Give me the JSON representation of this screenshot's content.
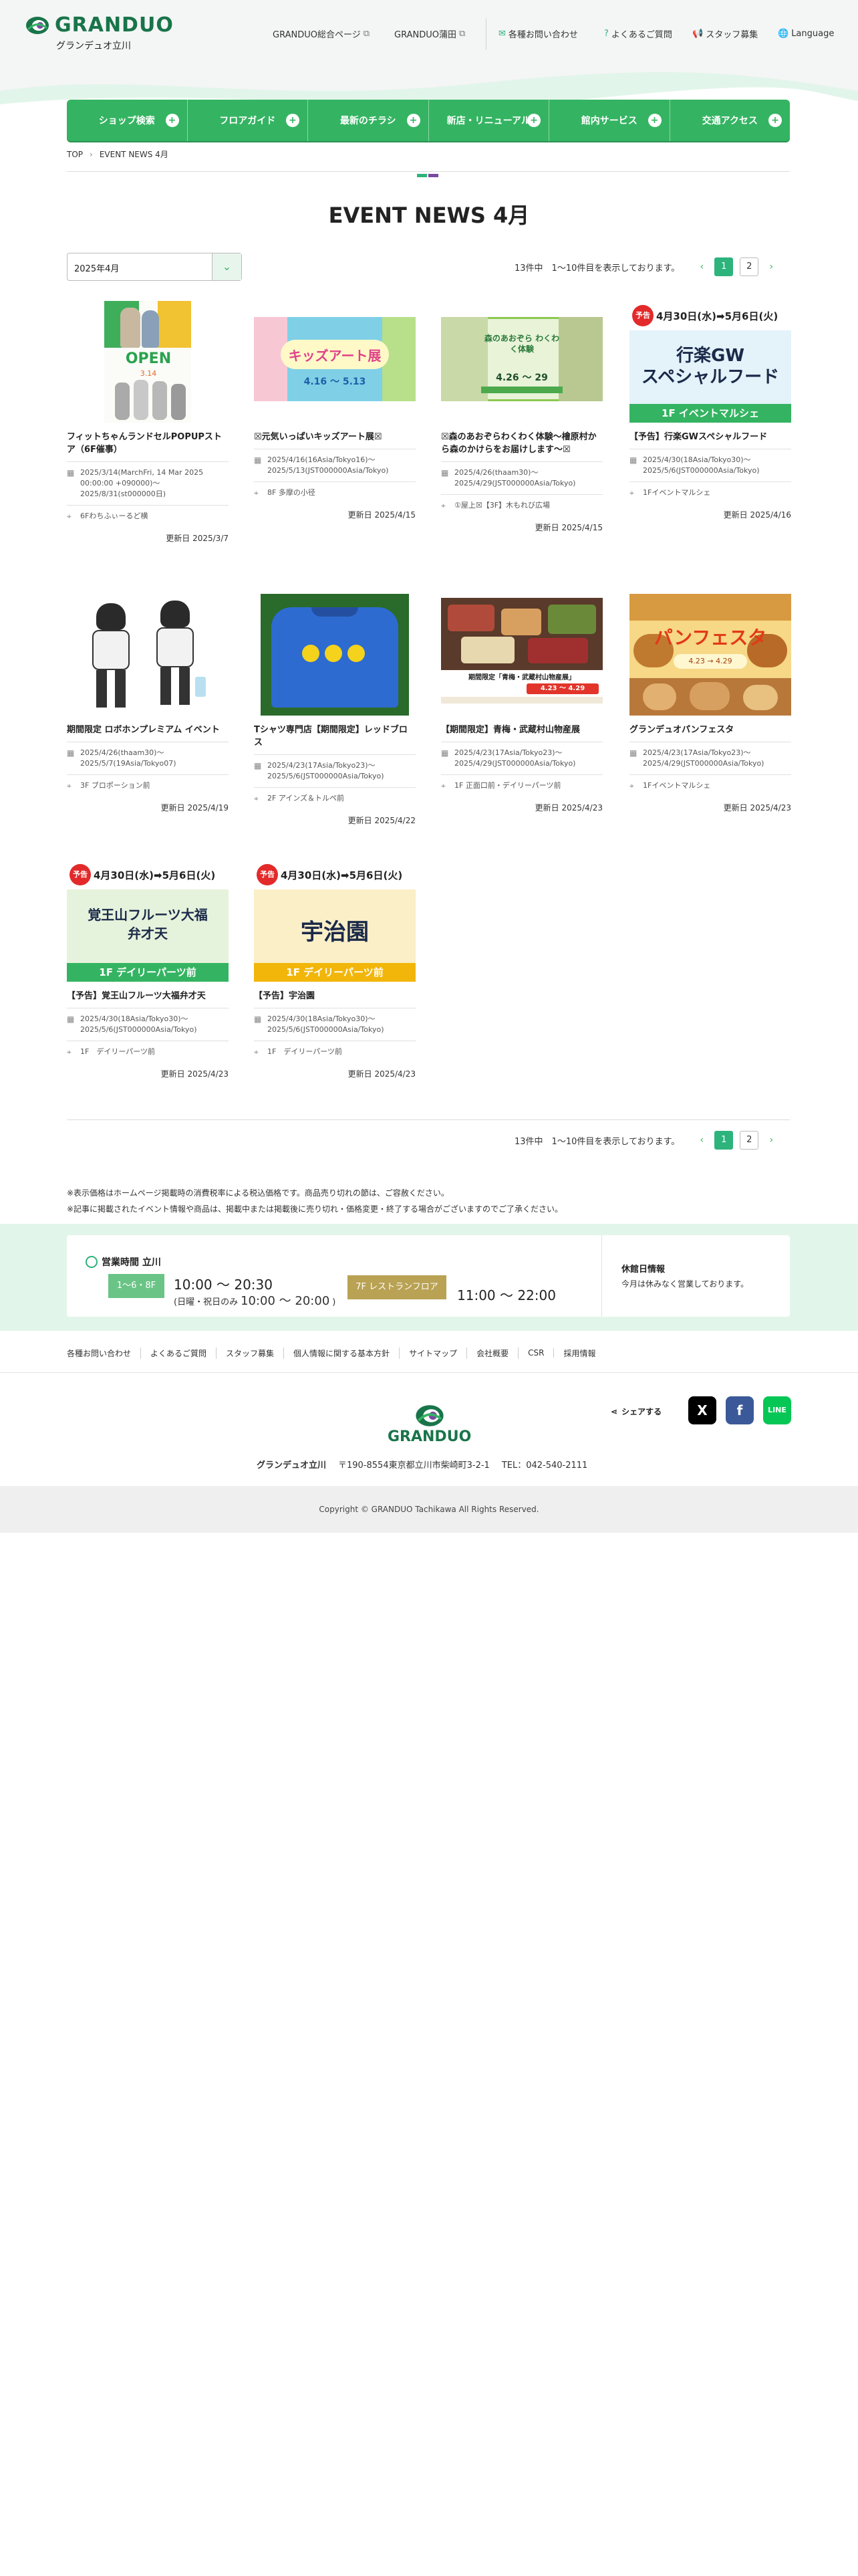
{
  "header": {
    "logo_text": "GRANDUO",
    "logo_sub": "グランデュオ立川",
    "util": [
      {
        "label": "GRANDUO総合ページ",
        "icon": "external-link-icon"
      },
      {
        "label": "GRANDUO蒲田",
        "icon": "external-link-icon"
      },
      {
        "label": "各種お問い合わせ",
        "icon": "mail-icon"
      },
      {
        "label": "よくあるご質問",
        "icon": "question-icon"
      },
      {
        "label": "スタッフ募集",
        "icon": "megaphone-icon"
      },
      {
        "label": "Language",
        "icon": "globe-icon"
      }
    ]
  },
  "nav": {
    "items": [
      "ショップ検索",
      "フロアガイド",
      "最新のチラシ",
      "新店・リニューアル",
      "館内サービス",
      "交通アクセス"
    ]
  },
  "breadcrumb": {
    "home": "TOP",
    "current": "EVENT NEWS 4月"
  },
  "page_title": "EVENT NEWS 4月",
  "filter": {
    "selected": "2025年4月"
  },
  "pagination": {
    "summary": "13件中　1〜10件目を表示しております。",
    "pages": [
      "1",
      "2"
    ],
    "current": "1",
    "prev": "‹",
    "next": "›"
  },
  "cards": [
    {
      "title": "フィットちゃんランドセルPOPUPストア（6F催事）",
      "date": "2025/3/14(MarchFri, 14 Mar 2025 00:00:00 +090000)〜2025/8/31(st000000日)",
      "place": "6Fわちふぃーるど横",
      "updated": "更新日 2025/3/7",
      "thumb": {
        "caption": "OPEN",
        "sub": "3.14"
      }
    },
    {
      "title": "☒元気いっぱいキッズアート展☒",
      "date": "2025/4/16(16Asia/Tokyo16)〜2025/5/13(JST000000Asia/Tokyo)",
      "place": "8F 多摩の小径",
      "updated": "更新日 2025/4/15",
      "thumb": {
        "caption": "キッズアート展",
        "sub": "4.16 〜 5.13"
      }
    },
    {
      "title": "☒森のあおぞらわくわく体験〜檜原村から森のかけらをお届けします〜☒",
      "date": "2025/4/26(thaam30)〜2025/4/29(JST000000Asia/Tokyo)",
      "place": "①屋上☒【3F】木もれび広場",
      "updated": "更新日 2025/4/15",
      "thumb": {
        "caption": "森のあおぞら わくわく体験",
        "sub": "4.26 〜 29"
      }
    },
    {
      "title": "【予告】行楽GWスペシャルフード",
      "date": "2025/4/30(18Asia/Tokyo30)〜2025/5/6(JST000000Asia/Tokyo)",
      "place": "1Fイベントマルシェ",
      "updated": "更新日 2025/4/16",
      "thumb": {
        "badge": "予告",
        "dates": "4月30日(水)➡5月6日(火)",
        "caption": "行楽GW\nスペシャルフード",
        "band": "1F イベントマルシェ"
      }
    },
    {
      "title": "期間限定 ロボホンプレミアム イベント",
      "date": "2025/4/26(thaam30)〜2025/5/7(19Asia/Tokyo07)",
      "place": "3F ブロポーション前",
      "updated": "更新日 2025/4/19",
      "thumb": {}
    },
    {
      "title": "Tシャツ専門店【期間限定】レッドブロス",
      "date": "2025/4/23(17Asia/Tokyo23)〜2025/5/6(JST000000Asia/Tokyo)",
      "place": "2F アインズ＆トルペ前",
      "updated": "更新日 2025/4/22",
      "thumb": {}
    },
    {
      "title": "【期間限定】青梅・武蔵村山物産展",
      "date": "2025/4/23(17Asia/Tokyo23)〜2025/4/29(JST000000Asia/Tokyo)",
      "place": "1F 正面口前・デイリーパーツ前",
      "updated": "更新日 2025/4/23",
      "thumb": {
        "caption": "期間限定「青梅・武蔵村山物産展」",
        "sub": "4.23 〜 4.29"
      }
    },
    {
      "title": "グランデュオパンフェスタ",
      "date": "2025/4/23(17Asia/Tokyo23)〜2025/4/29(JST000000Asia/Tokyo)",
      "place": "1Fイベントマルシェ",
      "updated": "更新日 2025/4/23",
      "thumb": {
        "caption": "パンフェスタ",
        "sub": "4.23 → 4.29"
      }
    },
    {
      "title": "【予告】覚王山フルーツ大福弁才天",
      "date": "2025/4/30(18Asia/Tokyo30)〜2025/5/6(JST000000Asia/Tokyo)",
      "place": "1F　デイリーパーツ前",
      "updated": "更新日 2025/4/23",
      "thumb": {
        "badge": "予告",
        "dates": "4月30日(水)➡5月6日(火)",
        "caption": "覚王山フルーツ大福\n弁才天",
        "band": "1F デイリーパーツ前"
      }
    },
    {
      "title": "【予告】宇治園",
      "date": "2025/4/30(18Asia/Tokyo30)〜2025/5/6(JST000000Asia/Tokyo)",
      "place": "1F　デイリーパーツ前",
      "updated": "更新日 2025/4/23",
      "thumb": {
        "badge": "予告",
        "dates": "4月30日(水)➡5月6日(火)",
        "caption": "宇治園",
        "band": "1F デイリーパーツ前"
      }
    }
  ],
  "notes": [
    "※表示価格はホームページ掲載時の消費税率による税込価格です。商品売り切れの節は、ご容赦ください。",
    "※記事に掲載されたイベント情報や商品は、掲載中または掲載後に売り切れ・価格変更・終了する場合がございますのでご了承ください。"
  ],
  "hours": {
    "title": "営業時間 立川",
    "floor1": "1〜6・8F",
    "floor1_time": "10:00 〜 20:30",
    "floor1_sub_label": "(日曜・祝日のみ",
    "floor1_sub_time": "10:00 〜 20:00",
    "floor1_sub_end": ")",
    "floor2": "7F レストランフロア",
    "floor2_time": "11:00 〜 22:00",
    "holiday_title": "休館日情報",
    "holiday_text": "今月は休みなく営業しております。"
  },
  "footer": {
    "links": [
      "各種お問い合わせ",
      "よくあるご質問",
      "スタッフ募集",
      "個人情報に関する基本方針",
      "サイトマップ",
      "会社概要",
      "CSR",
      "採用情報"
    ],
    "share_label": "シェアする",
    "sns": [
      "X",
      "f",
      "LINE"
    ],
    "logo_text": "GRANDUO",
    "name": "グランデュオ立川",
    "address": "〒190-8554東京都立川市柴崎町3-2-1",
    "tel": "TEL：042-540-2111",
    "copyright": "Copyright © GRANDUO Tachikawa All Rights Reserved."
  },
  "colors": {
    "brand_green": "#34b462",
    "page_green": "#2db37c",
    "light_green": "#e2f5ea",
    "logo_green": "#19744a",
    "accent_purple": "#7a4aa0"
  }
}
